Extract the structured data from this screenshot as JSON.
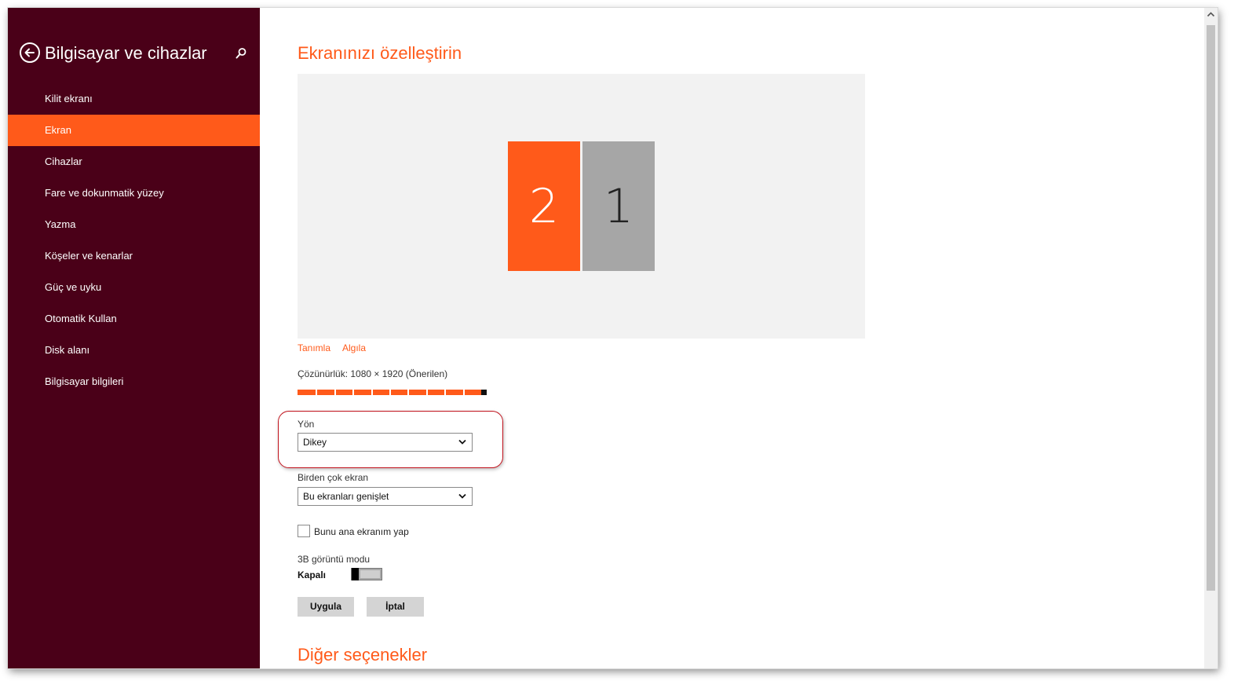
{
  "sidebar": {
    "title": "Bilgisayar ve cihazlar",
    "back_icon": "back-arrow-icon",
    "search_icon": "search-icon",
    "items": [
      {
        "label": "Kilit ekranı"
      },
      {
        "label": "Ekran",
        "active": true
      },
      {
        "label": "Cihazlar"
      },
      {
        "label": "Fare ve dokunmatik yüzey"
      },
      {
        "label": "Yazma"
      },
      {
        "label": "Köşeler ve kenarlar"
      },
      {
        "label": "Güç ve uyku"
      },
      {
        "label": "Otomatik Kullan"
      },
      {
        "label": "Disk alanı"
      },
      {
        "label": "Bilgisayar bilgileri"
      }
    ]
  },
  "main": {
    "title": "Ekranınızı özelleştirin",
    "monitors": [
      {
        "number": "2",
        "active": true
      },
      {
        "number": "1",
        "active": false
      }
    ],
    "identify_link": "Tanımla",
    "detect_link": "Algıla",
    "resolution_label": "Çözünürlük: 1080 × 1920 (Önerilen)",
    "resolution_level": 1.0,
    "orientation": {
      "label": "Yön",
      "value": "Dikey"
    },
    "multiple_displays": {
      "label": "Birden çok ekran",
      "value": "Bu ekranları genişlet"
    },
    "main_display_checkbox": {
      "label": "Bunu ana ekranım yap",
      "checked": false
    },
    "stereo_3d": {
      "label": "3B görüntü modu",
      "state_label": "Kapalı",
      "on": false
    },
    "apply_button": "Uygula",
    "cancel_button": "İptal",
    "next_section": "Diğer seçenekler"
  },
  "colors": {
    "accent": "#ff5a1a",
    "sidebar_bg": "#4a0018",
    "annotation": "#c0111b"
  }
}
